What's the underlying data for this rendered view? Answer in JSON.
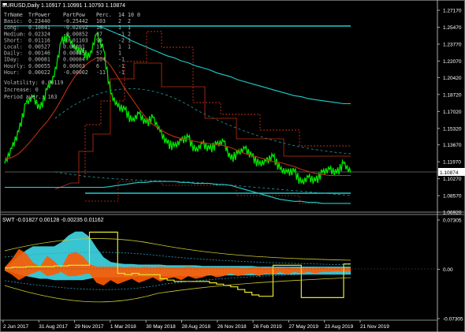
{
  "main_title": "EURUSD,Daily  1.10917 1.10991 1.10793 1.10874",
  "indicator_title": "SWT -0.01827 0.00128 -0.00235 0.01162",
  "price_label": "1.10874",
  "table": {
    "header": [
      "TrName",
      "TrPower",
      "PartPow",
      "Perc.",
      "14",
      "10",
      "0"
    ],
    "rows": [
      [
        "Basic:",
        "0.23440",
        "-0.25442",
        "103",
        "2",
        "2",
        ""
      ],
      [
        "Long:",
        "0.10841",
        "-0.02092",
        "18",
        "1",
        "1",
        ""
      ],
      [
        "Medium:",
        "0.02324",
        "-0.00852",
        "37",
        "-1",
        "2",
        ""
      ],
      [
        "Short:",
        "0.01116",
        "-0.01103",
        "99",
        "-2",
        "1",
        ""
      ],
      [
        "Local:",
        "0.00527",
        "0.00091",
        "17",
        "1",
        "1",
        ""
      ],
      [
        "Daily:",
        "0.00146",
        "0.00085",
        "57",
        "1",
        "",
        ""
      ],
      [
        "IDay:",
        "0.00081",
        "0.00084",
        "104",
        "-1",
        "",
        ""
      ],
      [
        "Hourly:",
        "0.00055",
        "0.00003",
        "6",
        "-1",
        "",
        ""
      ],
      [
        "Hour:",
        "0.00022",
        "-0.00002",
        "-11",
        "-1",
        "",
        ""
      ]
    ],
    "footer": [
      "Volatility: 0.00119",
      "Increase: 0",
      "Period aver.: 163"
    ]
  },
  "chart_data": [
    {
      "type": "line",
      "title": "EURUSD,Daily 1.10917 1.10991 1.10793 1.10874",
      "x_ticks": [
        "2 Jun 2017",
        "31 Aug 2017",
        "29 Nov 2017",
        "1 Mar 2018",
        "30 May 2018",
        "28 Aug 2018",
        "26 Nov 2018",
        "26 Feb 2019",
        "27 May 2019",
        "23 Aug 2019",
        "21 Nov 2019"
      ],
      "y_ticks": [
        "1.27170",
        "1.25470",
        "1.23770",
        "1.22070",
        "1.20420",
        "1.18720",
        "1.17020",
        "1.15320",
        "1.13670",
        "1.11970",
        "1.10270",
        "1.08570",
        "1.06920"
      ],
      "ylim": [
        1.0692,
        1.2717
      ],
      "grid": false,
      "current_price": 1.10874,
      "series": [
        {
          "name": "EURUSD",
          "color": "#00e600",
          "values": [
            1.118,
            1.133,
            1.15,
            1.178,
            1.185,
            1.172,
            1.192,
            1.205,
            1.24,
            1.245,
            1.232,
            1.23,
            1.224,
            1.248,
            1.232,
            1.188,
            1.175,
            1.172,
            1.16,
            1.168,
            1.158,
            1.164,
            1.15,
            1.138,
            1.135,
            1.141,
            1.144,
            1.13,
            1.138,
            1.132,
            1.137,
            1.14,
            1.122,
            1.128,
            1.133,
            1.125,
            1.117,
            1.12,
            1.125,
            1.112,
            1.109,
            1.11,
            1.098,
            1.104,
            1.1,
            1.109,
            1.112,
            1.108,
            1.118,
            1.109
          ]
        },
        {
          "name": "Trend1",
          "color": "#22cccc",
          "values": [
            1.256,
            1.256,
            1.256,
            1.256,
            1.256,
            1.256,
            1.256,
            1.256,
            1.256,
            1.256,
            1.256,
            1.256,
            1.256,
            1.256,
            1.254,
            1.251,
            1.248,
            1.245,
            1.241,
            1.238,
            1.235,
            1.232,
            1.229,
            1.226,
            1.224,
            1.221,
            1.219,
            1.216,
            1.214,
            1.212,
            1.209,
            1.207,
            1.205,
            1.202,
            1.2,
            1.198,
            1.196,
            1.194,
            1.192,
            1.19,
            1.188,
            1.186,
            1.185,
            1.183,
            1.182,
            1.181,
            1.18,
            1.179,
            1.178,
            1.178
          ]
        },
        {
          "name": "Trend2",
          "color": "#22cccc",
          "values": [
            1.094,
            1.094,
            1.094,
            1.094,
            1.094,
            1.094,
            1.094,
            1.094,
            1.094,
            1.094,
            1.094,
            1.094,
            1.094,
            1.094,
            1.094,
            1.095,
            1.096,
            1.097,
            1.098,
            1.099,
            1.099,
            1.1,
            1.1,
            1.1,
            1.1,
            1.099,
            1.099,
            1.098,
            1.098,
            1.098,
            1.097,
            1.097,
            1.096,
            1.094,
            1.092,
            1.09,
            1.088,
            1.086,
            1.084,
            1.082,
            1.081,
            1.08,
            1.08,
            1.079,
            1.079,
            1.078,
            1.078,
            1.078,
            1.078,
            1.078
          ]
        },
        {
          "name": "Trend3",
          "color": "#c03010",
          "values": [
            1.122,
            1.124,
            1.128,
            1.135,
            1.143,
            1.152,
            1.16,
            1.17,
            1.182,
            1.195,
            1.206,
            1.214,
            1.22,
            1.224,
            1.224,
            1.216,
            1.205,
            1.193,
            1.183,
            1.173,
            1.164,
            1.157,
            1.152,
            1.148,
            1.145,
            1.143,
            1.142,
            1.14,
            1.139,
            1.138,
            1.137,
            1.136,
            1.134,
            1.131,
            1.128,
            1.126,
            1.124,
            1.122,
            1.12,
            1.119,
            1.117,
            1.115,
            1.112,
            1.11,
            1.108,
            1.107,
            1.106,
            1.106,
            1.106,
            1.106
          ]
        }
      ]
    },
    {
      "type": "area",
      "title": "SWT -0.01827 0.00128 -0.00235 0.01162",
      "x_ticks": [
        "2 Jun 2017",
        "31 Aug 2017",
        "29 Nov 2017",
        "1 Mar 2018",
        "30 May 2018",
        "28 Aug 2018",
        "26 Nov 2018",
        "26 Feb 2019",
        "27 May 2019",
        "23 Aug 2019",
        "21 Nov 2019"
      ],
      "y_ticks": [
        "0.07305",
        "0.00",
        "-0.07305"
      ],
      "ylim": [
        -0.07305,
        0.07305
      ],
      "grid": false,
      "series": [
        {
          "name": "cyan",
          "color": "#3ccfdc",
          "upper": [
            0.002,
            0.01,
            0.02,
            0.028,
            0.034,
            0.034,
            0.034,
            0.034,
            0.04,
            0.05,
            0.056,
            0.056,
            0.048,
            0.032,
            0.018,
            0.011,
            0.009,
            0.008,
            0.008,
            0.007,
            0.007,
            0.007,
            0.007,
            0.006,
            0.006,
            0.006,
            0.006,
            0.006,
            0.005,
            0.005,
            0.005,
            0.005,
            0.005,
            0.005,
            0.005,
            0.005,
            0.004,
            0.004,
            0.004,
            0.004,
            0.004,
            0.004,
            0.004,
            0.004,
            0.004,
            0.004,
            0.004,
            0.004,
            0.004,
            0.004
          ],
          "lower": [
            -0.002,
            -0.004,
            -0.008,
            -0.01,
            -0.012,
            -0.014,
            -0.014,
            -0.016,
            -0.016,
            -0.016,
            -0.016,
            -0.016,
            -0.014,
            -0.012,
            -0.012,
            -0.012,
            -0.012,
            -0.012,
            -0.012,
            -0.011,
            -0.011,
            -0.011,
            -0.01,
            -0.01,
            -0.01,
            -0.01,
            -0.01,
            -0.01,
            -0.01,
            -0.009,
            -0.009,
            -0.009,
            -0.009,
            -0.009,
            -0.009,
            -0.009,
            -0.009,
            -0.008,
            -0.008,
            -0.008,
            -0.008,
            -0.008,
            -0.008,
            -0.008,
            -0.008,
            -0.008,
            -0.008,
            -0.008,
            -0.008,
            -0.008
          ]
        },
        {
          "name": "orange",
          "color": "#ff5a00",
          "upper": [
            0.003,
            0.015,
            0.03,
            0.024,
            0.01,
            0.004,
            0.02,
            0.012,
            0.002,
            0.022,
            0.026,
            0.02,
            0.008,
            0.004,
            0.004,
            0.004,
            0.004,
            0.003,
            0.004,
            0.003,
            0.004,
            0.003,
            0.004,
            0.003,
            0.003,
            0.003,
            0.004,
            0.003,
            0.003,
            0.003,
            0.003,
            0.003,
            0.003,
            0.003,
            0.002,
            0.003,
            0.003,
            0.002,
            0.003,
            0.002,
            0.003,
            0.002,
            0.002,
            0.002,
            0.002,
            0.003,
            0.002,
            0.002,
            0.002,
            0.002
          ],
          "lower": [
            -0.002,
            -0.008,
            -0.016,
            -0.01,
            -0.006,
            -0.002,
            -0.01,
            -0.008,
            -0.004,
            -0.01,
            -0.01,
            -0.008,
            -0.006,
            -0.02,
            -0.024,
            -0.016,
            -0.022,
            -0.018,
            -0.014,
            -0.02,
            -0.016,
            -0.012,
            -0.018,
            -0.014,
            -0.012,
            -0.016,
            -0.01,
            -0.014,
            -0.012,
            -0.008,
            -0.012,
            -0.01,
            -0.006,
            -0.01,
            -0.008,
            -0.006,
            -0.01,
            -0.006,
            -0.008,
            -0.004,
            -0.008,
            -0.004,
            -0.006,
            -0.004,
            -0.006,
            -0.004,
            -0.004,
            -0.003,
            -0.004,
            -0.003
          ]
        },
        {
          "name": "yellow-boxes",
          "color": "#e6e62a",
          "values": [
            0.002,
            0.003,
            0.003,
            0.004,
            0.004,
            0.004,
            0.004,
            0.005,
            0.005,
            0.006,
            0.006,
            0.006,
            0.055,
            0.055,
            0.055,
            0.055,
            -0.006,
            -0.008,
            -0.006,
            -0.008,
            -0.008,
            -0.008,
            -0.014,
            -0.016,
            -0.018,
            -0.018,
            -0.018,
            -0.018,
            -0.018,
            -0.02,
            -0.022,
            -0.024,
            -0.026,
            -0.03,
            -0.034,
            -0.038,
            -0.04,
            -0.04,
            0.006,
            0.006,
            0.006,
            0.006,
            -0.042,
            -0.042,
            -0.042,
            -0.042,
            -0.042,
            -0.042,
            0.008,
            0.008
          ]
        }
      ]
    }
  ]
}
